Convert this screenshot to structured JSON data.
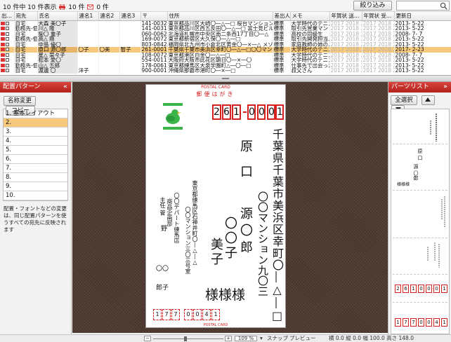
{
  "topbar": {
    "count_prefix": "10 件中 10 件表示",
    "print_count": "10 件",
    "mail_count": "0 件",
    "filter_label": "絞り込み",
    "search_value": ""
  },
  "table": {
    "columns": [
      "出…",
      "宛先",
      "氏名",
      "連名1",
      "連名2",
      "連名3",
      "〒",
      "住所",
      "差出人",
      "メモ",
      "年賀状 送…",
      "年賀状 受…",
      "更新日"
    ],
    "rows": [
      {
        "dest": "自宅",
        "name": "大森 美〇子",
        "ren1": "",
        "ren2": "",
        "ren3": "",
        "zip": "141-0032",
        "addr": "東京都品川区大崎〇―△―□ 桜台マンション602…",
        "sender": "標準",
        "memo": "大学時代のテニス…",
        "sent": "2017 2018 20",
        "recv": "2017 2018 20",
        "updated": "2013- 5-22"
      },
      {
        "dest": "勤務先-個",
        "name": "川△ 隆",
        "ren1": "",
        "ren2": "",
        "ren3": "",
        "zip": "141-0031",
        "addr": "東京都品川区西五反田〇―△―□ 富士見ビル2F",
        "sender": "標準",
        "memo": "取引先営業マン",
        "sent": "2017 2018 20",
        "recv": "2017 2018 20",
        "updated": "2013- 5-22"
      },
      {
        "dest": "自宅",
        "name": "柴〇 重子",
        "ren1": "",
        "ren2": "",
        "ren3": "",
        "zip": "060-0062",
        "addr": "北海道札幌市中央区南二条西17丁目〇―△",
        "sender": "標準",
        "memo": "高校の同級生",
        "sent": "2017 2018 20",
        "recv": "2017 2018 20",
        "updated": "2008- 7- 7"
      },
      {
        "dest": "勤務先-個",
        "name": "高△ 剛",
        "ren1": "",
        "ren2": "",
        "ren3": "",
        "zip": "169-0072",
        "addr": "東京都新宿区大久保〇―△―□",
        "sender": "標準",
        "memo": "取引先開発担当…",
        "sent": "2017 2018 20",
        "recv": "2017 2018 20",
        "updated": "2013- 5-22"
      },
      {
        "dest": "自宅",
        "name": "中島 優〇",
        "ren1": "",
        "ren2": "",
        "ren3": "",
        "zip": "803-0842",
        "addr": "福岡県北九州市小倉北区黄金〇―×―△ メゾン…",
        "sender": "標準",
        "memo": "家庭教師の姉の…",
        "sent": "2017 2018 20",
        "recv": "2017 2018 20",
        "updated": "2013- 5-22"
      },
      {
        "dest": "自宅",
        "name": "原口 源〇郎",
        "ren1": "〇子",
        "ren2": "〇美",
        "ren3": "智子",
        "zip": "261-0001",
        "addr": "千葉県千葉市美浜区幸町〇―△―□〇〇マンション…",
        "sender": "標準",
        "memo": "大学時代のテニス…",
        "sent": "2017 2018 20",
        "recv": "2017 2018 20",
        "updated": "2017- 2-23"
      },
      {
        "dest": "自宅",
        "name": "星△ 菜々子",
        "ren1": "",
        "ren2": "",
        "ren3": "",
        "zip": "108-0072",
        "addr": "東京都港区白金〇―△―□",
        "sender": "標準",
        "memo": "大学時代のテニス…",
        "sent": "2017 2018 20",
        "recv": "2017 2018 20",
        "updated": "2008- 7- 7"
      },
      {
        "dest": "自宅",
        "name": "松本 愛〇",
        "ren1": "",
        "ren2": "",
        "ren3": "",
        "zip": "554-0011",
        "addr": "大阪府大阪市此花区朝日〇―×―〇",
        "sender": "標準",
        "memo": "大学時代のテニス…",
        "sent": "2017 2018 20",
        "recv": "2017 2018 20",
        "updated": "2013- 5-22"
      },
      {
        "dest": "勤務先-個",
        "name": "山△ 五郎",
        "ren1": "",
        "ren2": "",
        "ren3": "",
        "zip": "178-0061",
        "addr": "東京都練馬区大泉学園町△―〇―□",
        "sender": "標準",
        "memo": "仕事先で出会った…",
        "sent": "2017 2018 20",
        "recv": "2017 2018 20",
        "updated": "2013- 5-22"
      },
      {
        "dest": "自宅",
        "name": "渡邊 〇",
        "ren1": "洋子",
        "ren2": "",
        "ren3": "",
        "zip": "900-0001",
        "addr": "沖縄県那覇市港町〇―×―□",
        "sender": "標準",
        "memo": "叔父さん",
        "sent": "2017 2018 20",
        "recv": "2017 2018 20",
        "updated": "2013- 5-22"
      }
    ],
    "selected_index": 5
  },
  "left_panel": {
    "title": "配置パターン",
    "rename_label": "名称変更",
    "copy_label": "コピー",
    "patterns": [
      "1. 基本レイアウト",
      "2.",
      "3.",
      "4.",
      "5.",
      "6.",
      "7.",
      "8.",
      "9.",
      "10."
    ],
    "active_index": 1,
    "note": "配置・フォントなどの変更は、同じ配置パターンを使うすべての宛先に反映されます"
  },
  "card": {
    "top_text": "POSTAL CARD",
    "header": "郵便はがき",
    "zip_digits": [
      "2",
      "6",
      "1",
      "0",
      "0",
      "0",
      "1"
    ],
    "addr_line1": "千葉県千葉市美浜区幸町〇―△―□",
    "addr_line2": "〇〇マンション九〇三",
    "surname": "原口",
    "given_main": "源〇郎",
    "given_2": "〇〇子",
    "given_3": "美子",
    "honorifics": [
      "様",
      "様",
      "様"
    ],
    "sender_addr1": "東京都練馬区石神井町〇―△―△",
    "sender_addr2": "〇〇マンション三〇三号室",
    "sender_company": "〇〇デパート練馬店",
    "sender_dept": "商品企画部",
    "sender_title": "主任 菅",
    "sender_surname": "野",
    "sender_given1": "〇〇",
    "sender_given2": "郎子",
    "sender_zip_digits": [
      "1",
      "7",
      "7",
      "0",
      "0",
      "4",
      "1"
    ],
    "bottom_text": "POSTAL CARD"
  },
  "right_panel": {
    "title": "パーツリスト",
    "select_all_label": "全選択",
    "part_surname": "原 口",
    "part_given": "源 〇郎",
    "part_honor": "様様様",
    "zip_digits": [
      "2",
      "6",
      "1",
      "0",
      "0",
      "0",
      "1"
    ],
    "sender_zip_digits": [
      "1",
      "7",
      "7",
      "0",
      "0",
      "4",
      "1"
    ]
  },
  "status": {
    "zoom": "109 %",
    "snap": "スナップ",
    "preview": "プレビュー",
    "coords": "横 0.0 縦 0.0 幅 100.0 高さ 148.0"
  },
  "colors": {
    "accent_red": "#d42020",
    "selection": "#f6c97c",
    "stamp_green": "#3bb44a",
    "canvas_brown": "#4e3a30"
  }
}
